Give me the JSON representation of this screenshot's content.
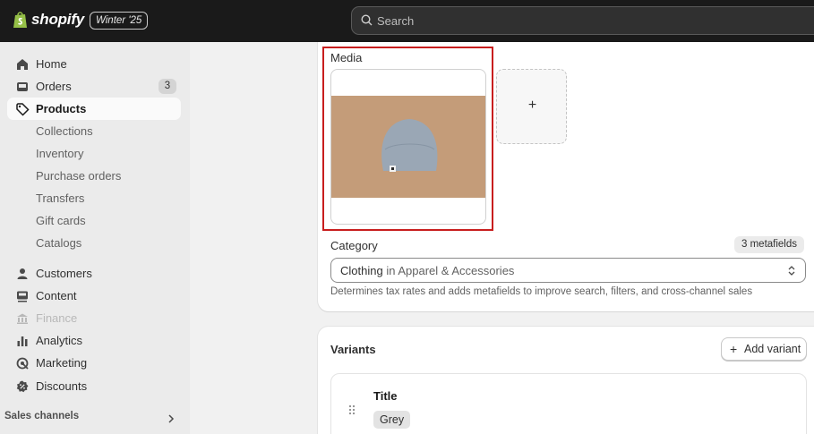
{
  "topbar": {
    "brand": "shopify",
    "edition": "Winter '25",
    "search_placeholder": "Search"
  },
  "sidebar": {
    "items": [
      {
        "label": "Home",
        "icon": "home-icon"
      },
      {
        "label": "Orders",
        "icon": "inbox-icon",
        "badge": "3"
      },
      {
        "label": "Products",
        "icon": "tag-icon",
        "active": true
      }
    ],
    "product_subitems": [
      "Collections",
      "Inventory",
      "Purchase orders",
      "Transfers",
      "Gift cards",
      "Catalogs"
    ],
    "items2": [
      {
        "label": "Customers",
        "icon": "person-icon"
      },
      {
        "label": "Content",
        "icon": "content-icon"
      },
      {
        "label": "Finance",
        "icon": "bank-icon",
        "disabled": true
      },
      {
        "label": "Analytics",
        "icon": "bar-chart-icon"
      },
      {
        "label": "Marketing",
        "icon": "target-icon"
      },
      {
        "label": "Discounts",
        "icon": "discount-icon"
      }
    ],
    "sales_channels": "Sales channels"
  },
  "media": {
    "title": "Media",
    "add_symbol": "+"
  },
  "category": {
    "label": "Category",
    "metafields": "3 metafields",
    "value": "Clothing",
    "connector": "in",
    "parent": "Apparel & Accessories",
    "help": "Determines tax rates and adds metafields to improve search, filters, and cross-channel sales"
  },
  "variants": {
    "title": "Variants",
    "add_label": "Add variant",
    "option_name": "Title",
    "option_value": "Grey"
  },
  "colors": {
    "topbar": "#1a1a1a",
    "highlight": "#c81e1e",
    "sidebar": "#ebebeb"
  }
}
